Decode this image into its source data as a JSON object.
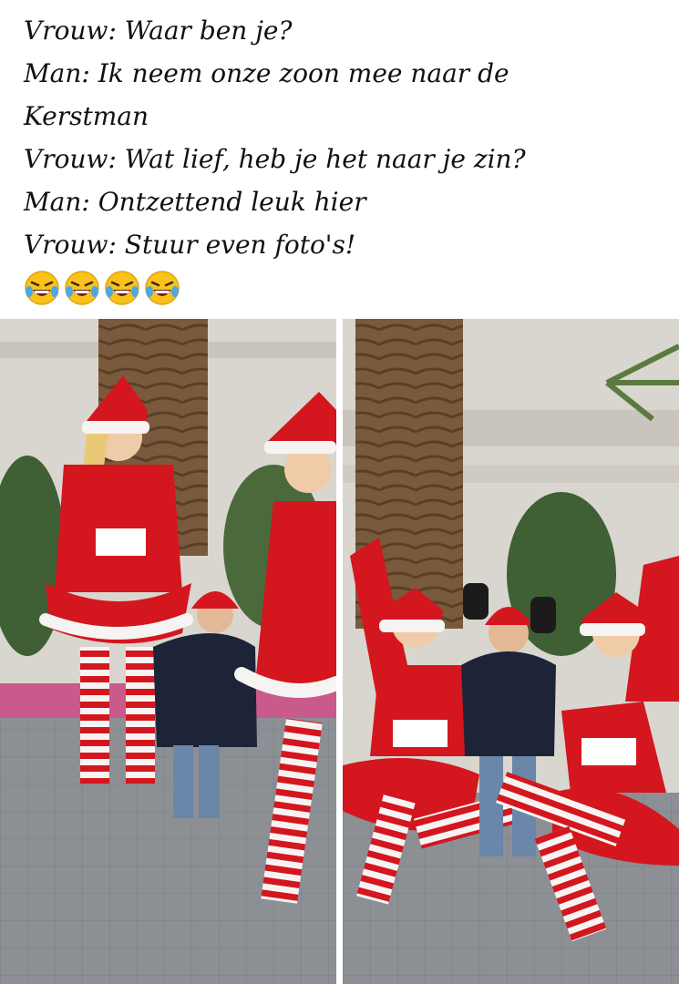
{
  "caption": {
    "lines": [
      "Vrouw: Waar ben je?",
      "Man: Ik neem onze zoon mee naar de",
      "Kerstman",
      "Vrouw: Wat lief, heb je het naar je zin?",
      "Man: Ontzettend leuk hier",
      "Vrouw: Stuur even foto's!"
    ],
    "emojis": [
      "rolling-on-floor-laughing-emoji",
      "rolling-on-floor-laughing-emoji",
      "rolling-on-floor-laughing-emoji",
      "rolling-on-floor-laughing-emoji"
    ]
  },
  "colors": {
    "santa_red": "#d4161f",
    "fur_white": "#f6f4f2",
    "sidewalk": "#8c8f94",
    "wall": "#d9d6cf",
    "palm_trunk": "#7a5a3c",
    "child_jacket": "#1d2438"
  },
  "photos": [
    {
      "id": "left-photo",
      "alt": ""
    },
    {
      "id": "right-photo",
      "alt": ""
    }
  ]
}
